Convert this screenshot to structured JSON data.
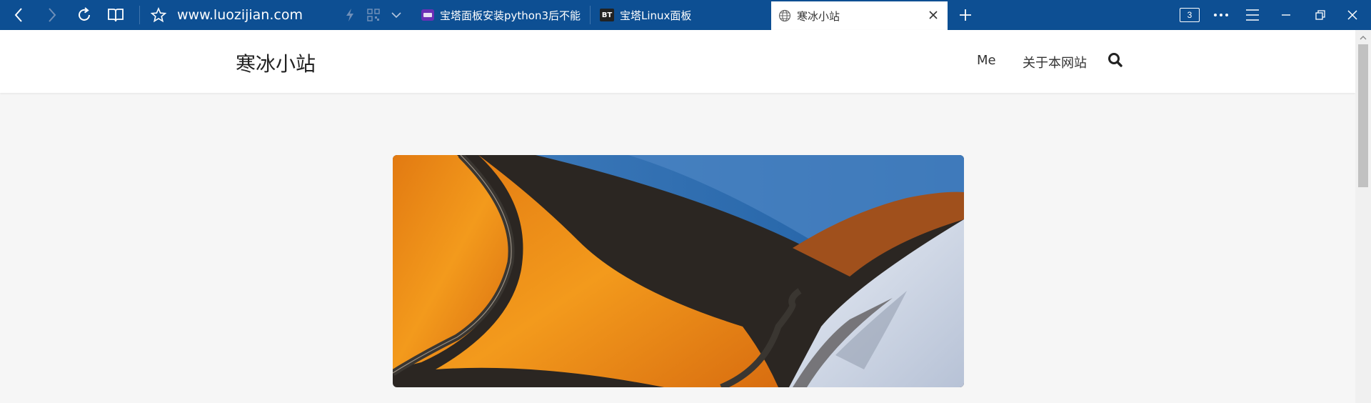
{
  "browser": {
    "url": "www.luozijian.com",
    "tabs": [
      {
        "title": "宝塔面板安装python3后不能",
        "favicon": "baota-purple-icon"
      },
      {
        "title": "宝塔Linux面板",
        "favicon_text": "BT"
      },
      {
        "title": "寒冰小站",
        "favicon": "globe-icon",
        "active": true
      }
    ],
    "tab_count": "3",
    "colors": {
      "chrome": "#0d4f93",
      "active_tab": "#ffffff"
    }
  },
  "site": {
    "title": "寒冰小站",
    "nav": [
      "Me",
      "关于本网站"
    ]
  },
  "hero": {
    "description": "orange desert road mountain snow"
  }
}
